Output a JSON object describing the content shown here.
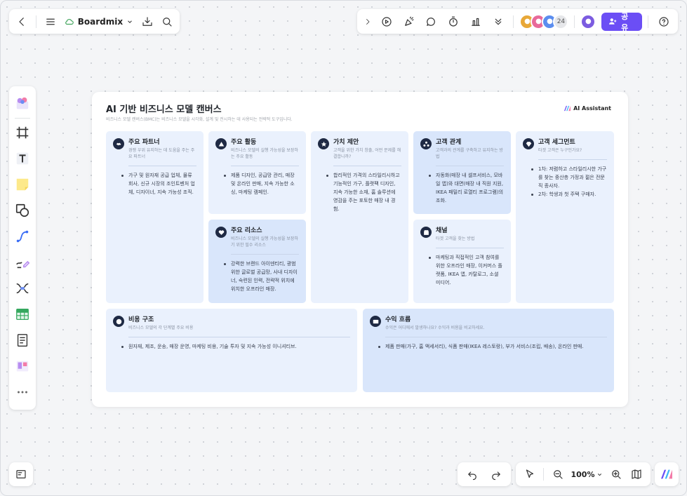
{
  "app": {
    "name": "Boardmix",
    "share_label": "공유",
    "collaborator_count": "24",
    "zoom": "100%"
  },
  "colors": {
    "accent": "#6b4ef5",
    "card_light": "#eaf1fd",
    "card_dark": "#d9e6fb"
  },
  "board": {
    "title": "AI 기반 비즈니스 모델 캔버스",
    "subtitle": "비즈니스 모델 캔버스(BMC)는 비즈니스 모델을 시각화, 설계 및 전시하는 데 사용되는 전략적 도구입니다.",
    "ai_badge": "AI Assistant",
    "cards": {
      "partners": {
        "title": "주요 파트너",
        "desc": "경쟁 우위 유지하는 데 도움을 주는 주요 파트너",
        "body": [
          "가구 및 원자재 공급 업체, 물류 회사, 신규 시장의 조인트벤처 업체, 디자이너, 지속 가능성 조직."
        ]
      },
      "activities": {
        "title": "주요 활동",
        "desc": "비즈니스 모델의 실행 가능성을 보장하는 주요 활동",
        "body": [
          "제품 디자인, 공급망 관리, 매장 및 온라인 판매, 지속 가능한 소싱, 마케팅 캠페인."
        ]
      },
      "resources": {
        "title": "주요 리소스",
        "desc": "비즈니스 모델의 실행 가능성을 보장하기 위한 필수 리소스",
        "body": [
          "강력한 브랜드 아이덴티티, 광범위한 글로벌 공급망, 사내 디자이너, 숙련된 인력, 전략적 위치에 위치한 오프라인 매장."
        ]
      },
      "value": {
        "title": "가치 제안",
        "desc": "고객을 위한 가치 창출, 어떤 문제를 해결합니까?",
        "body": [
          "합리적인 가격의 스타일리시하고 기능적인 가구, 플랫팩 디자인, 지속 가능한 소재, 홈 솔루션에 영감을 주는 포토한 매장 내 경험."
        ]
      },
      "relationships": {
        "title": "고객 관계",
        "desc": "고객과의 관계를 구축하고 유지하는 방법",
        "body": [
          "자동화(매장 내 셀프서비스, 모바일 앱)와 대면(매장 내 직원 지원, IKEA 패밀리 로열티 프로그램)의 조화."
        ]
      },
      "channels": {
        "title": "채널",
        "desc": "타겟 고객을 찾는 방법",
        "body": [
          "마케팅과 직접적인 고객 참여를 위한 오프라인 매장, 이커머스 플랫폼, IKEA 앱, 카탈로그, 소셜 미디어."
        ]
      },
      "segments": {
        "title": "고객 세그먼트",
        "desc": "타겟 고객은 누구인가요?",
        "body": [
          "1차: 저렴하고 스타일리시한 가구를 찾는 중산층 가정과 젊은 전문직 종사자.",
          "2차: 학생과 첫 주택 구매자."
        ]
      },
      "costs": {
        "title": "비용 구조",
        "desc": "비즈니스 모델의 각 단계별 주요 비용",
        "body": [
          "원자재, 제조, 운송, 매장 운영, 마케팅 비용, 기술 투자 및 지속 가능성 이니셔티브."
        ]
      },
      "revenue": {
        "title": "수익 흐름",
        "desc": "수익은 어디에서 발생하나요? 수익과 비용을 비교하세요.",
        "body": [
          "제품 판매(가구, 홈 액세서리), 식품 판매(IKEA 레스토랑), 부가 서비스(조립, 배송), 온라인 판매."
        ]
      }
    }
  },
  "icons": {
    "top_left": [
      "back-icon",
      "menu-icon",
      "cloud-icon",
      "download-icon",
      "search-icon"
    ],
    "top_right": [
      "chevron-right-icon",
      "play-icon",
      "celebrate-icon",
      "comment-icon",
      "timer-icon",
      "vote-icon",
      "more-down-icon",
      "help-icon"
    ],
    "left": [
      "templates-icon",
      "frame-icon",
      "text-icon",
      "sticky-note-icon",
      "shape-icon",
      "connector-icon",
      "pen-icon",
      "mindmap-icon",
      "table-icon",
      "document-icon",
      "kanban-icon",
      "more-icon"
    ],
    "bottom": [
      "minimap-icon",
      "undo-icon",
      "redo-icon",
      "select-icon",
      "zoom-out-icon",
      "zoom-in-icon",
      "map-icon",
      "ai-logo-icon"
    ]
  }
}
